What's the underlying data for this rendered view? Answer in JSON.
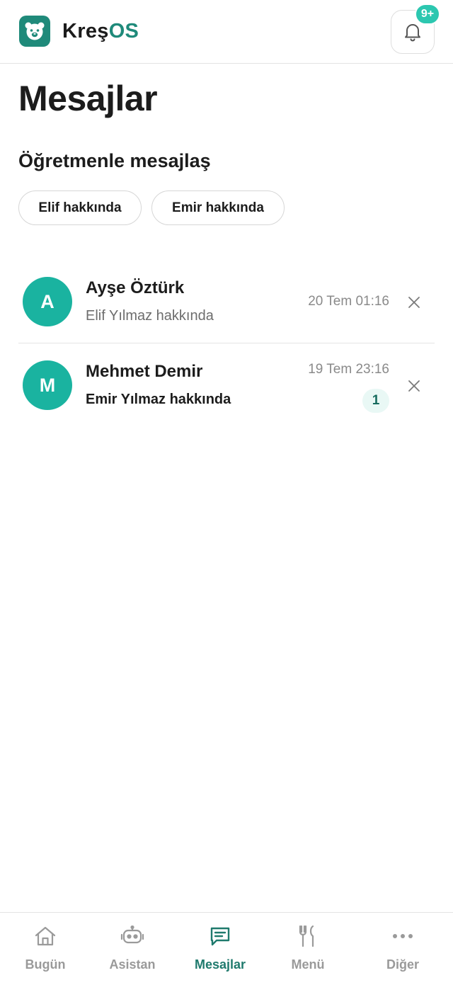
{
  "app": {
    "brand_part1": "Kreş",
    "brand_part2": "OS",
    "notification_badge": "9+"
  },
  "page": {
    "title": "Mesajlar",
    "section_title": "Öğretmenle mesajlaş",
    "chips": [
      "Elif hakkında",
      "Emir hakkında"
    ]
  },
  "conversations": [
    {
      "initial": "A",
      "name": "Ayşe Öztürk",
      "subtitle": "Elif Yılmaz hakkında",
      "time": "20 Tem 01:16",
      "unread": null
    },
    {
      "initial": "M",
      "name": "Mehmet Demir",
      "subtitle": "Emir Yılmaz hakkında",
      "time": "19 Tem 23:16",
      "unread": "1"
    }
  ],
  "nav": [
    {
      "label": "Bugün",
      "icon": "home-icon",
      "active": false
    },
    {
      "label": "Asistan",
      "icon": "robot-icon",
      "active": false
    },
    {
      "label": "Mesajlar",
      "icon": "message-icon",
      "active": true
    },
    {
      "label": "Menü",
      "icon": "fork-knife-icon",
      "active": false
    },
    {
      "label": "Diğer",
      "icon": "more-dots-icon",
      "active": false
    }
  ],
  "colors": {
    "brand": "#1f8a7a",
    "avatar": "#1ab3a0",
    "badge": "#2cc7b0",
    "active_nav": "#1f7a6d"
  }
}
